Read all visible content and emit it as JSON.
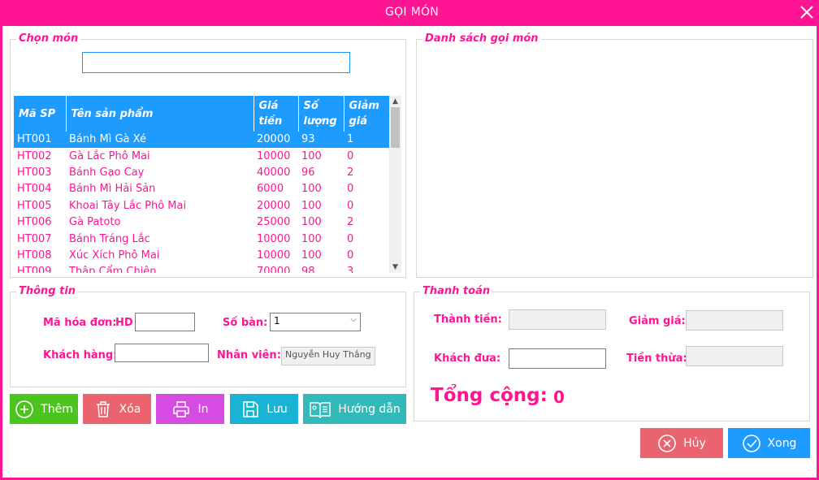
{
  "window": {
    "title": "GỌI MÓN"
  },
  "chon_mon": {
    "legend": "Chọn món",
    "search_value": "",
    "columns": [
      "Mã SP",
      "Tên sản phẩm",
      "Giá tiền",
      "Số lượng",
      "Giảm giá"
    ],
    "rows": [
      {
        "ma": "HT001",
        "ten": "Bánh Mì Gà Xé",
        "gia": "20000",
        "sl": "93",
        "gg": "1"
      },
      {
        "ma": "HT002",
        "ten": "Gà Lắc Phô Mai",
        "gia": "10000",
        "sl": "100",
        "gg": "0"
      },
      {
        "ma": "HT003",
        "ten": "Bánh Gạo Cay",
        "gia": "40000",
        "sl": "96",
        "gg": "2"
      },
      {
        "ma": "HT004",
        "ten": "Bánh Mì Hải Sản",
        "gia": "6000",
        "sl": "100",
        "gg": "0"
      },
      {
        "ma": "HT005",
        "ten": "Khoai Tây Lắc Phô Mai",
        "gia": "20000",
        "sl": "100",
        "gg": "0"
      },
      {
        "ma": "HT006",
        "ten": "Gà Patoto",
        "gia": "25000",
        "sl": "100",
        "gg": "2"
      },
      {
        "ma": "HT007",
        "ten": "Bánh Tráng Lắc",
        "gia": "10000",
        "sl": "100",
        "gg": "0"
      },
      {
        "ma": "HT008",
        "ten": "Xúc Xích Phô Mai",
        "gia": "10000",
        "sl": "100",
        "gg": "0"
      },
      {
        "ma": "HT009",
        "ten": "Thập Cẩm Chiên",
        "gia": "70000",
        "sl": "98",
        "gg": "3"
      }
    ]
  },
  "danh_sach": {
    "legend": "Danh sách gọi món"
  },
  "thong_tin": {
    "legend": "Thông tin",
    "ma_hoa_don_label": "Mã hóa đơn:",
    "ma_hoa_don_prefix": "HD",
    "ma_hoa_don_value": "",
    "so_ban_label": "Số bàn:",
    "so_ban_value": "1",
    "khach_hang_label": "Khách hàng:",
    "khach_hang_value": "",
    "nhan_vien_label": "Nhân viên:",
    "nhan_vien_value": "Nguyễn Huy Thắng"
  },
  "thanh_toan": {
    "legend": "Thanh toán",
    "thanh_tien_label": "Thành tiền:",
    "thanh_tien_value": "",
    "giam_gia_label": "Giảm giá:",
    "giam_gia_value": "",
    "khach_dua_label": "Khách đưa:",
    "khach_dua_value": "",
    "tien_thua_label": "Tiền thừa:",
    "tien_thua_value": "",
    "tong_cong_label": "Tổng cộng:",
    "tong_cong_value": "0"
  },
  "buttons": {
    "them": "Thêm",
    "xoa": "Xóa",
    "in": "In",
    "luu": "Lưu",
    "huong_dan": "Hướng dẫn",
    "huy": "Hủy",
    "xong": "Xong"
  },
  "colors": {
    "accent": "#ff1493",
    "grid_header": "#1e9bff",
    "them": "#4cc31e",
    "xoa": "#e9646e",
    "in": "#d64ce2",
    "luu": "#1ab3d3",
    "huong_dan": "#33b9b7",
    "huy": "#e9646e",
    "xong": "#1e9bff"
  }
}
